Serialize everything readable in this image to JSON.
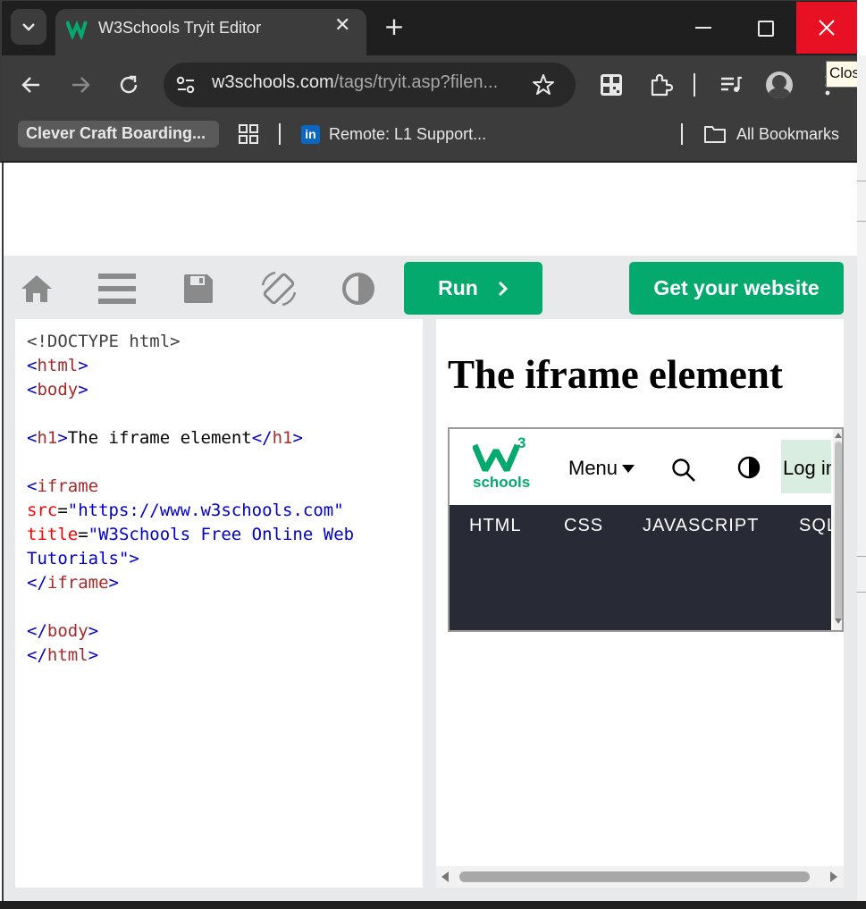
{
  "browser": {
    "tab_title": "W3Schools Tryit Editor",
    "url_domain": "w3schools.com",
    "url_path": "/tags/tryit.asp?filen...",
    "tooltip": "Close",
    "bookmarks": [
      {
        "label": "Clever Craft Boarding..."
      },
      {
        "label": "Remote: L1 Support..."
      }
    ],
    "all_bookmarks": "All Bookmarks"
  },
  "editor": {
    "run_label": "Run",
    "get_website_label": "Get your website",
    "code": {
      "l1": "<!DOCTYPE html>",
      "html": "html",
      "body": "body",
      "h1": "h1",
      "h1_text": "The iframe element",
      "iframe": "iframe",
      "src_attr": "src",
      "src_val": "\"https://www.w3schools.com\"",
      "title_attr": "title",
      "title_val1": "\"W3Schools Free Online Web",
      "title_val2": "Tutorials\""
    }
  },
  "result": {
    "heading": "The iframe element",
    "w3_logo_sup": "3",
    "w3_logo_text": "schools",
    "menu": "Menu",
    "login": "Log in",
    "nav": [
      "HTML",
      "CSS",
      "JAVASCRIPT",
      "SQL"
    ]
  },
  "colors": {
    "w3_green": "#04aa6d",
    "nav_dark": "#282a35",
    "close_red": "#e81123"
  }
}
